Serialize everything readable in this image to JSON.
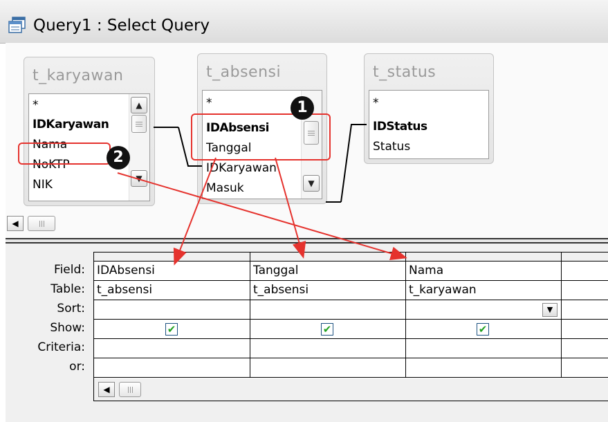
{
  "window": {
    "title": "Query1 : Select Query",
    "icon": "query-icon"
  },
  "tables": [
    {
      "name": "t_karyawan",
      "fields": [
        {
          "label": "*",
          "key": false
        },
        {
          "label": "IDKaryawan",
          "key": true
        },
        {
          "label": "Nama",
          "key": false
        },
        {
          "label": "NoKTP",
          "key": false
        },
        {
          "label": "NIK",
          "key": false
        }
      ]
    },
    {
      "name": "t_absensi",
      "fields": [
        {
          "label": "*",
          "key": false
        },
        {
          "label": "IDAbsensi",
          "key": true
        },
        {
          "label": "Tanggal",
          "key": false
        },
        {
          "label": "IDKaryawan",
          "key": false
        },
        {
          "label": "Masuk",
          "key": false
        }
      ]
    },
    {
      "name": "t_status",
      "fields": [
        {
          "label": "*",
          "key": false
        },
        {
          "label": "IDStatus",
          "key": true
        },
        {
          "label": "Status",
          "key": false
        }
      ]
    }
  ],
  "grid": {
    "row_labels": [
      "Field:",
      "Table:",
      "Sort:",
      "Show:",
      "Criteria:",
      "or:"
    ],
    "columns": [
      {
        "field": "IDAbsensi",
        "table": "t_absensi",
        "show": true
      },
      {
        "field": "Tanggal",
        "table": "t_absensi",
        "show": true
      },
      {
        "field": "Nama",
        "table": "t_karyawan",
        "show": true
      }
    ]
  },
  "callouts": [
    "1",
    "2"
  ],
  "colors": {
    "callout": "#e5322d",
    "check": "#21a121"
  }
}
